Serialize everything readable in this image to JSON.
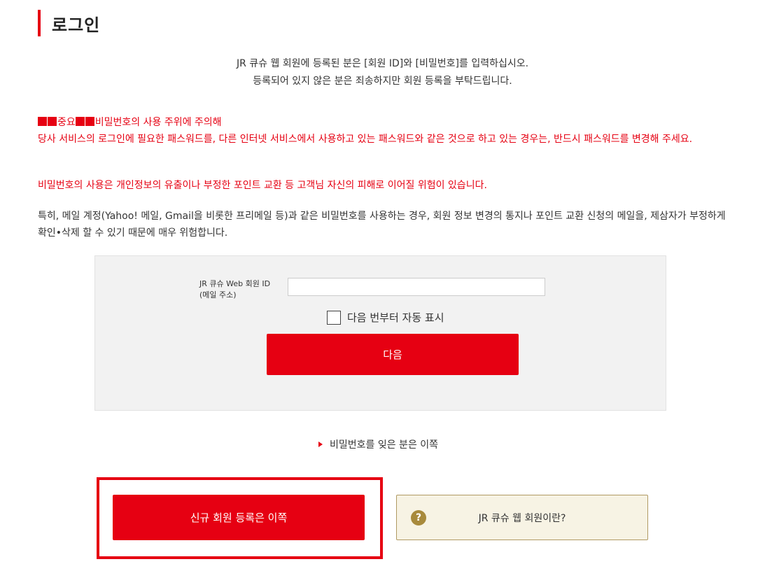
{
  "page": {
    "title": "로그인"
  },
  "intro": {
    "line1": "JR 큐슈 웹 회원에 등록된 분은 [회원 ID]와 [비밀번호]를 입력하십시오.",
    "line2": "등록되어 있지 않은 분은 죄송하지만 회원 등록을 부탁드립니다."
  },
  "warning": {
    "heading_text": "중요",
    "heading_tail": "비밀번호의 사용 주위에 주의해",
    "body": "당사 서비스의 로그인에 필요한 패스워드를, 다른 인터넷 서비스에서 사용하고 있는 패스워드와 같은 것으로 하고 있는 경우는, 반드시 패스워드를 변경해 주세요.",
    "risk": "비밀번호의 사용은 개인정보의 유출이나 부정한 포인트 교환 등 고객님 자신의 피해로 이어질 위험이 있습니다."
  },
  "note": {
    "text": "특히, 메일 계정(Yahoo! 메일, Gmail을 비롯한 프리메일 등)과 같은 비밀번호를 사용하는 경우, 회원 정보 변경의 통지나 포인트 교환 신청의 메일을, 제삼자가 부정하게 확인•삭제 할 수 있기 때문에 매우 위험합니다."
  },
  "login": {
    "id_label_line1": "JR 큐슈 Web 회원 ID",
    "id_label_line2": "(메일 주소)",
    "id_value": "",
    "auto_login_label": "다음 번부터 자동 표시",
    "auto_login_checked": false,
    "next_button": "다음"
  },
  "forgot": {
    "label": "비밀번호를 잊은 분은 이쪽"
  },
  "actions": {
    "register_button": "신규 회원 등록은 이쪽",
    "about_button": "JR 큐슈 웹 회원이란?",
    "about_icon": "question-circle-icon"
  },
  "colors": {
    "accent": "#e60012",
    "box_bg": "#f2f2f2",
    "about_bg": "#f7f3e4",
    "about_icon": "#a88a3c"
  }
}
